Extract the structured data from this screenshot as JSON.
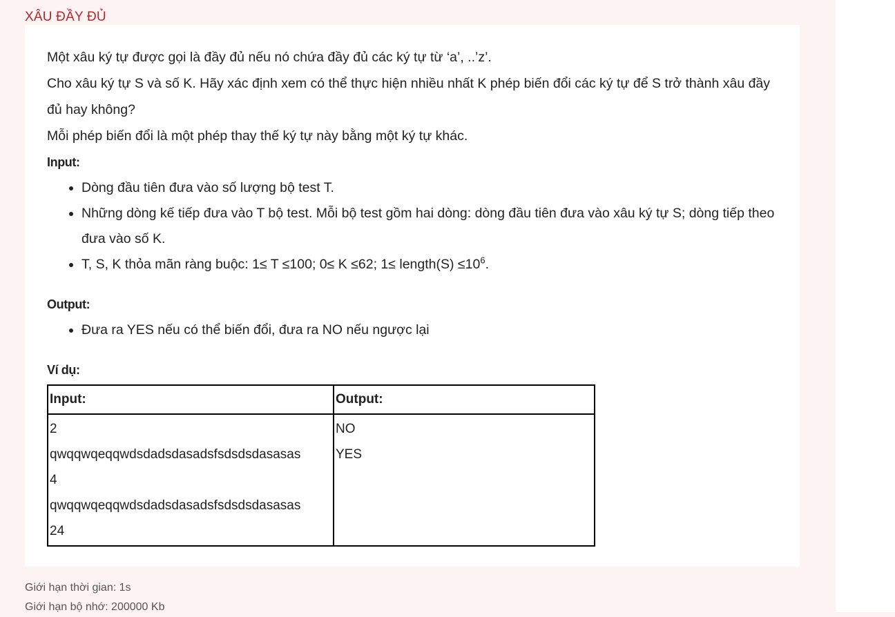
{
  "problem": {
    "title": "XÂU ĐẦY ĐỦ",
    "statement": [
      "Một xâu ký tự được gọi là đầy đủ nếu nó chứa đầy đủ các ký tự từ ‘a’, ..’z’.",
      "Cho xâu ký tự S và số K. Hãy xác định xem có thể thực hiện nhiều nhất K phép biến đổi các ký tự để S trở thành xâu đầy đủ hay không?",
      "Mỗi phép biến đổi là một phép thay thế ký tự này bằng một ký tự khác."
    ],
    "input_label": "Input:",
    "input_items": [
      "Dòng đầu tiên đưa vào số lượng bộ test T.",
      "Những dòng kế tiếp đưa vào T bộ test. Mỗi bộ test gồm hai dòng: dòng đầu tiên đưa vào xâu ký tự S; dòng tiếp theo đưa vào số K."
    ],
    "constraint_text": "T, S, K thỏa mãn ràng buộc: 1≤ T ≤100; 0≤ K ≤62; 1≤ length(S) ≤10",
    "constraint_exp": "6",
    "constraint_end": ".",
    "output_label": "Output:",
    "output_items": [
      "Đưa ra YES nếu có thể biến đổi, đưa ra NO nếu ngược lại"
    ],
    "example_label": "Ví dụ:",
    "example_table": {
      "headers": [
        "Input:",
        "Output:"
      ],
      "input_lines": [
        "2",
        "qwqqwqeqqwdsdadsdasadsfsdsdsdasasas",
        "4",
        "qwqqwqeqqwdsdadsdasadsfsdsdsdasasas",
        "24"
      ],
      "output_lines": [
        "NO",
        "YES"
      ]
    }
  },
  "limits": {
    "time": "Giới hạn thời gian: 1s",
    "memory": "Giới hạn bộ nhớ: 200000 Kb"
  },
  "colors": {
    "title": "#b3272d",
    "background": "#fdf3f3",
    "card": "#ffffff"
  }
}
